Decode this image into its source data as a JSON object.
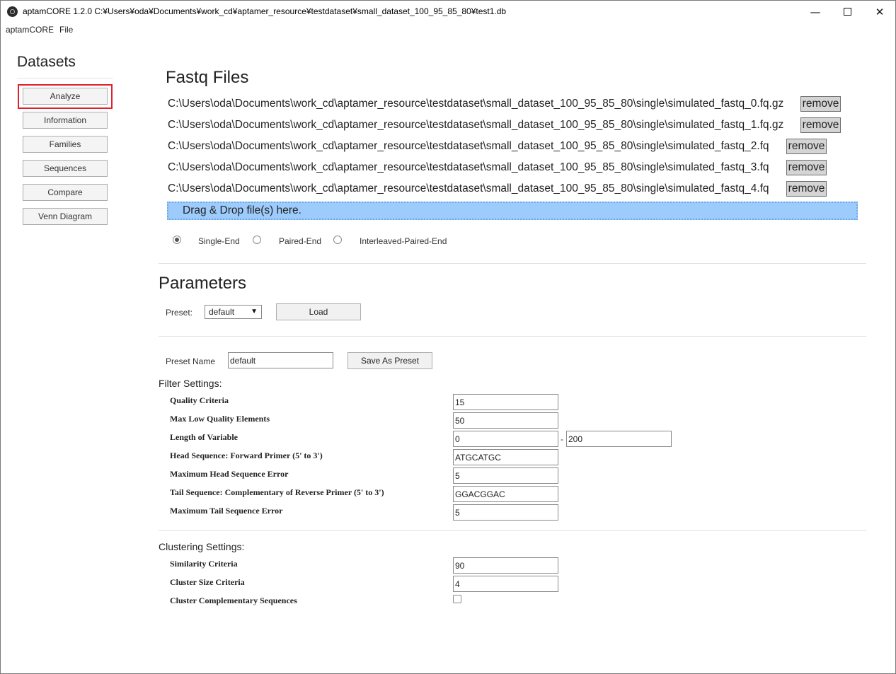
{
  "window": {
    "title": "aptamCORE 1.2.0 C:¥Users¥oda¥Documents¥work_cd¥aptamer_resource¥testdataset¥small_dataset_100_95_85_80¥test1.db",
    "minimize_glyph": "—",
    "close_glyph": "✕"
  },
  "menu": [
    "aptamCORE",
    "File"
  ],
  "sidebar": {
    "title": "Datasets",
    "items": [
      "Analyze",
      "Information",
      "Families",
      "Sequences",
      "Compare",
      "Venn Diagram"
    ],
    "selected": "Analyze",
    "highlight_color": "#e0202a"
  },
  "fastq": {
    "heading": "Fastq Files",
    "files": [
      "C:\\Users\\oda\\Documents\\work_cd\\aptamer_resource\\testdataset\\small_dataset_100_95_85_80\\single\\simulated_fastq_0.fq.gz",
      "C:\\Users\\oda\\Documents\\work_cd\\aptamer_resource\\testdataset\\small_dataset_100_95_85_80\\single\\simulated_fastq_1.fq.gz",
      "C:\\Users\\oda\\Documents\\work_cd\\aptamer_resource\\testdataset\\small_dataset_100_95_85_80\\single\\simulated_fastq_2.fq",
      "C:\\Users\\oda\\Documents\\work_cd\\aptamer_resource\\testdataset\\small_dataset_100_95_85_80\\single\\simulated_fastq_3.fq",
      "C:\\Users\\oda\\Documents\\work_cd\\aptamer_resource\\testdataset\\small_dataset_100_95_85_80\\single\\simulated_fastq_4.fq"
    ],
    "remove_label": "remove",
    "dropzone_text": "Drag & Drop file(s) here.",
    "dropzone_color": "#9dcbfb",
    "read_modes": [
      "Single-End",
      "Paired-End",
      "Interleaved-Paired-End"
    ],
    "selected_mode": "Single-End"
  },
  "parameters": {
    "heading": "Parameters",
    "preset_label": "Preset:",
    "preset_value": "default",
    "load_label": "Load",
    "preset_name_label": "Preset Name",
    "preset_name_value": "default",
    "save_preset_label": "Save As Preset"
  },
  "filter": {
    "heading": "Filter Settings:",
    "quality_criteria": {
      "label": "Quality Criteria",
      "value": "15"
    },
    "max_low_quality": {
      "label": "Max Low Quality Elements",
      "value": "50"
    },
    "length_variable": {
      "label": "Length of Variable",
      "min": "0",
      "separator": "-",
      "max": "200"
    },
    "head_sequence": {
      "label": "Head Sequence: Forward Primer (5' to 3')",
      "value": "ATGCATGC"
    },
    "max_head_error": {
      "label": "Maximum Head Sequence Error",
      "value": "5"
    },
    "tail_sequence": {
      "label": "Tail Sequence: Complementary of Reverse Primer (5' to 3')",
      "value": "GGACGGAC"
    },
    "max_tail_error": {
      "label": "Maximum Tail Sequence Error",
      "value": "5"
    }
  },
  "clustering": {
    "heading": "Clustering Settings:",
    "similarity": {
      "label": "Similarity Criteria",
      "value": "90"
    },
    "cluster_size": {
      "label": "Cluster Size Criteria",
      "value": "4"
    },
    "complementary": {
      "label": "Cluster Complementary Sequences",
      "checked": false
    }
  }
}
